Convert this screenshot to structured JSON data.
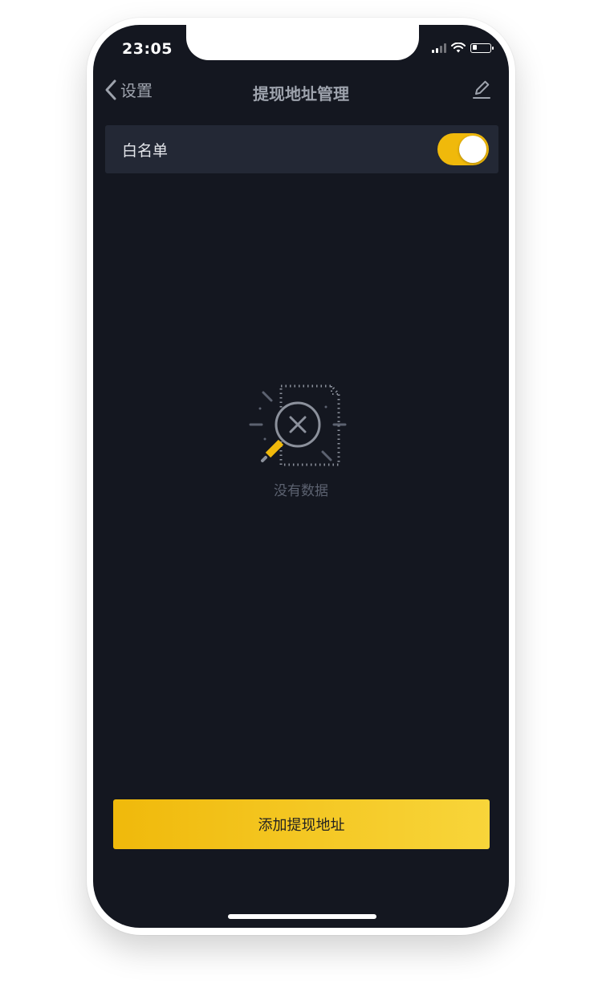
{
  "status_bar": {
    "time": "23:05",
    "battery_level": 0.25
  },
  "nav": {
    "back_label": "设置",
    "title": "提现地址管理",
    "back_icon": "chevron-left-icon",
    "edit_icon": "edit-pencil-icon"
  },
  "whitelist": {
    "label": "白名单",
    "enabled": true
  },
  "empty_state": {
    "icon": "no-data-magnifier-icon",
    "message": "没有数据"
  },
  "footer": {
    "add_button_label": "添加提现地址"
  },
  "colors": {
    "background": "#141720",
    "row_background": "#232835",
    "accent": "#f0b90b",
    "muted_text": "#9ea3ad"
  }
}
